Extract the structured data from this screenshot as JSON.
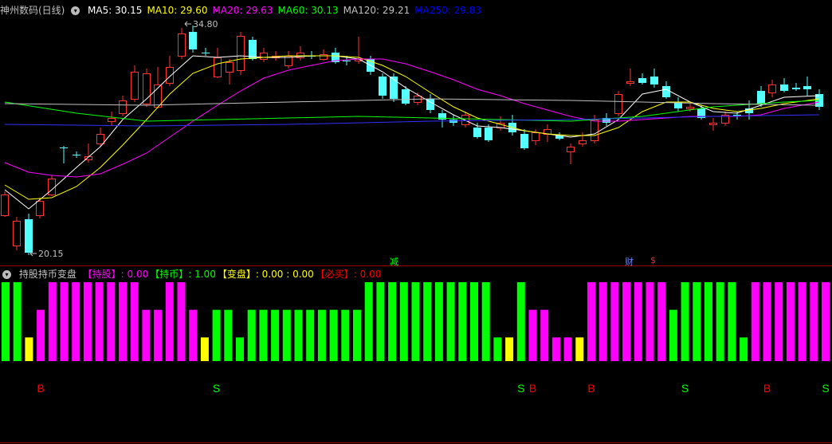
{
  "main_header": {
    "title": "神州数码(日线)",
    "items": [
      {
        "label": "MA5: 30.15",
        "color": "#ffffff"
      },
      {
        "label": "MA10: 29.60",
        "color": "#ffff00"
      },
      {
        "label": "MA20: 29.63",
        "color": "#ff00ff"
      },
      {
        "label": "MA60: 30.13",
        "color": "#00ff00"
      },
      {
        "label": "MA120: 29.21",
        "color": "#c0c0c0"
      },
      {
        "label": "MA250: 29.83",
        "color": "#0000ff"
      }
    ]
  },
  "annotations": {
    "high": "34.80",
    "low": "20.15",
    "mark_jian": "减",
    "mark_cai": "财",
    "mark_s": "$"
  },
  "sub_header": {
    "title": "持股持币变盘",
    "items": [
      {
        "label": "【持股】: 0.00",
        "color": "#ff00ff"
      },
      {
        "label": "【持币】: 1.00",
        "color": "#00ff00"
      },
      {
        "label": "【变盘】: 0.00 : 0.00",
        "color": "#ffff00"
      },
      {
        "label": "【必买】: 0.00",
        "color": "#ff0000"
      }
    ]
  },
  "chart_data": [
    {
      "type": "candlestick",
      "series_labels": [
        "MA5",
        "MA10",
        "MA20",
        "MA60",
        "MA120",
        "MA250"
      ],
      "high": 34.8,
      "low": 20.15
    },
    {
      "type": "bar",
      "title": "持股持币变盘",
      "levels": [
        1,
        1,
        0.3,
        0.65,
        1,
        1,
        1,
        1,
        1,
        1,
        1,
        1,
        0.65,
        0.65,
        1,
        1,
        0.65,
        0.3,
        0.65,
        0.65,
        0.3,
        0.65,
        0.65,
        0.65,
        0.65,
        0.65,
        0.65,
        0.65,
        0.65,
        0.65,
        0.65,
        1,
        1,
        1,
        1,
        1,
        1,
        1,
        1,
        1,
        1,
        1,
        0.3,
        0.3,
        1,
        0.65,
        0.65,
        0.3,
        0.3,
        0.3,
        1,
        1,
        1,
        1,
        1,
        1,
        1,
        0.65,
        1,
        1,
        1,
        1,
        1,
        0.3,
        1,
        1,
        1,
        1,
        1,
        1,
        1
      ],
      "colors": [
        "G",
        "G",
        "Y",
        "M",
        "M",
        "M",
        "M",
        "M",
        "M",
        "M",
        "M",
        "M",
        "M",
        "M",
        "M",
        "M",
        "M",
        "Y",
        "G",
        "G",
        "G",
        "G",
        "G",
        "G",
        "G",
        "G",
        "G",
        "G",
        "G",
        "G",
        "G",
        "G",
        "G",
        "G",
        "G",
        "G",
        "G",
        "G",
        "G",
        "G",
        "G",
        "G",
        "G",
        "Y",
        "G",
        "M",
        "M",
        "M",
        "M",
        "Y",
        "M",
        "M",
        "M",
        "M",
        "M",
        "M",
        "M",
        "G",
        "G",
        "G",
        "G",
        "G",
        "G",
        "G",
        "M",
        "M",
        "M",
        "M",
        "M",
        "M",
        "M"
      ],
      "signals": [
        {
          "bar": 3,
          "text": "B",
          "color": "#ff0000"
        },
        {
          "bar": 18,
          "text": "S",
          "color": "#00ff00"
        },
        {
          "bar": 44,
          "text": "S",
          "color": "#00ff00"
        },
        {
          "bar": 45,
          "text": "B",
          "color": "#ff0000"
        },
        {
          "bar": 50,
          "text": "B",
          "color": "#ff0000"
        },
        {
          "bar": 58,
          "text": "S",
          "color": "#00ff00"
        },
        {
          "bar": 65,
          "text": "B",
          "color": "#ff0000"
        },
        {
          "bar": 70,
          "text": "S",
          "color": "#00ff00"
        }
      ]
    }
  ]
}
